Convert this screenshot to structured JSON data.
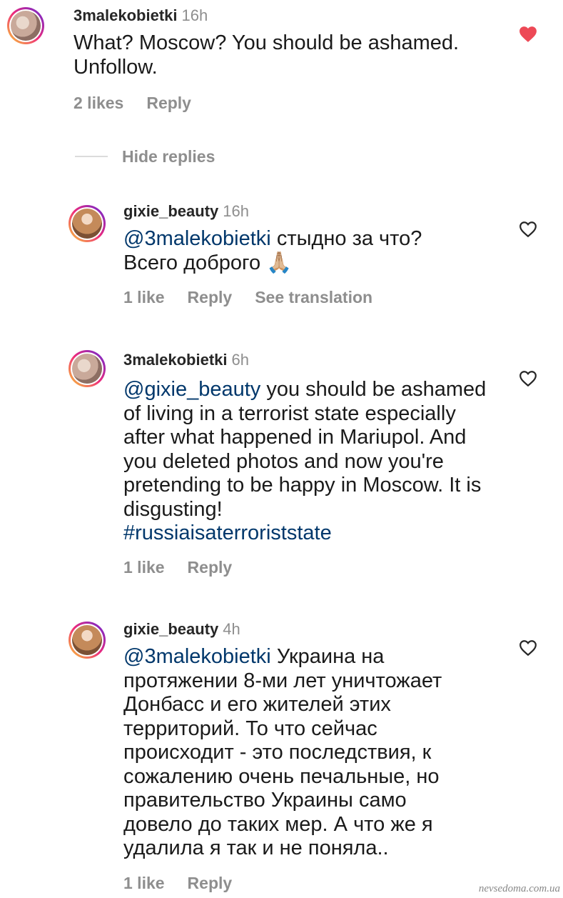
{
  "comments": [
    {
      "username": "3malekobietki",
      "time": "16h",
      "text": "What? Moscow? You should be ashamed. Unfollow.",
      "likes": "2 likes",
      "reply": "Reply",
      "liked": true
    },
    {
      "username": "gixie_beauty",
      "time": "16h",
      "mention": "@3malekobietki",
      "text": " стыдно за что? Всего доброго 🙏🏼",
      "likes": "1 like",
      "reply": "Reply",
      "see_translation": "See translation",
      "liked": false
    },
    {
      "username": "3malekobietki",
      "time": "6h",
      "mention": "@gixie_beauty",
      "text": " you should be ashamed of living in a terrorist state especially after what happened in Mariupol. And you deleted photos and now you're pretending to be happy in Moscow. It is disgusting!",
      "hashtag": "#russiaisaterroriststate",
      "likes": "1 like",
      "reply": "Reply",
      "liked": false
    },
    {
      "username": "gixie_beauty",
      "time": "4h",
      "mention": "@3malekobietki",
      "text": " Украина на протяжении 8-ми лет уничтожает Донбасс и его жителей этих территорий. То что сейчас происходит - это последствия, к сожалению очень печальные, но правительство Украины само довело до таких мер. А что же я удалила я так и не поняла..",
      "likes": "1 like",
      "reply": "Reply",
      "liked": false
    }
  ],
  "hide_replies": "Hide replies",
  "watermark": "nevsedoma.com.ua",
  "colors": {
    "heart_filled": "#ed4956",
    "mention": "#00376b",
    "meta": "#8e8e8e"
  },
  "icons": {
    "liked": "heart-filled-icon",
    "unliked": "heart-outline-icon"
  }
}
